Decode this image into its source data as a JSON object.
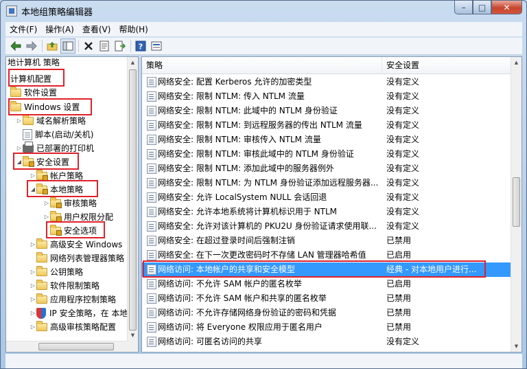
{
  "window": {
    "title": "本地组策略编辑器"
  },
  "caption": {
    "minimize": "–",
    "maximize": "□",
    "close": "✕"
  },
  "menu": [
    "文件(F)",
    "操作(A)",
    "查看(V)",
    "帮助(H)"
  ],
  "toolbar": {
    "icons": [
      "back-arrow-icon",
      "forward-arrow-icon",
      "up-folder-icon",
      "show-tree-icon",
      "delete-icon",
      "properties-icon",
      "export-icon",
      "help-icon",
      "view-icon"
    ]
  },
  "tree": {
    "root_label": "地计算机 策略",
    "items": [
      {
        "label": "计算机配置"
      },
      {
        "label": "软件设置"
      },
      {
        "label": "Windows 设置"
      },
      {
        "label": "域名解析策略"
      },
      {
        "label": "脚本(启动/关机)"
      },
      {
        "label": "已部署的打印机"
      },
      {
        "label": "安全设置"
      },
      {
        "label": "帐户策略"
      },
      {
        "label": "本地策略"
      },
      {
        "label": "审核策略"
      },
      {
        "label": "用户权限分配"
      },
      {
        "label": "安全选项"
      },
      {
        "label": "高级安全 Windows"
      },
      {
        "label": "网络列表管理器策略"
      },
      {
        "label": "公钥策略"
      },
      {
        "label": "软件限制策略"
      },
      {
        "label": "应用程序控制策略"
      },
      {
        "label": "IP 安全策略，在 本地"
      },
      {
        "label": "高级审核策略配置"
      }
    ]
  },
  "list": {
    "columns": {
      "policy": "策略",
      "setting": "安全设置"
    },
    "rows": [
      {
        "policy": "网络安全: 配置 Kerberos 允许的加密类型",
        "setting": "没有定义"
      },
      {
        "policy": "网络安全: 限制 NTLM: 传入 NTLM 流量",
        "setting": "没有定义"
      },
      {
        "policy": "网络安全: 限制 NTLM: 此域中的 NTLM 身份验证",
        "setting": "没有定义"
      },
      {
        "policy": "网络安全: 限制 NTLM: 到远程服务器的传出 NTLM 流量",
        "setting": "没有定义"
      },
      {
        "policy": "网络安全: 限制 NTLM: 审核传入 NTLM 流量",
        "setting": "没有定义"
      },
      {
        "policy": "网络安全: 限制 NTLM: 审核此域中的 NTLM 身份验证",
        "setting": "没有定义"
      },
      {
        "policy": "网络安全: 限制 NTLM: 添加此域中的服务器例外",
        "setting": "没有定义"
      },
      {
        "policy": "网络安全: 限制 NTLM: 为 NTLM 身份验证添加远程服务器...",
        "setting": "没有定义"
      },
      {
        "policy": "网络安全: 允许 LocalSystem NULL 会话回退",
        "setting": "没有定义"
      },
      {
        "policy": "网络安全: 允许本地系统将计算机标识用于 NTLM",
        "setting": "没有定义"
      },
      {
        "policy": "网络安全: 允许对该计算机的 PKU2U 身份验证请求使用联...",
        "setting": "没有定义"
      },
      {
        "policy": "网络安全: 在超过登录时间后强制注销",
        "setting": "已禁用"
      },
      {
        "policy": "网络安全: 在下一次更改密码时不存储 LAN 管理器哈希值",
        "setting": "已启用"
      },
      {
        "policy": "网络访问: 本地帐户的共享和安全模型",
        "setting": "经典 - 对本地用户进行..."
      },
      {
        "policy": "网络访问: 不允许 SAM 帐户的匿名枚举",
        "setting": "已启用"
      },
      {
        "policy": "网络访问: 不允许 SAM 帐户和共享的匿名枚举",
        "setting": "已禁用"
      },
      {
        "policy": "网络访问: 不允许存储网络身份验证的密码和凭据",
        "setting": "已禁用"
      },
      {
        "policy": "网络访问: 将 Everyone 权限应用于匿名用户",
        "setting": "已禁用"
      },
      {
        "policy": "网络访问: 可匿名访问的共享",
        "setting": "没有定义"
      }
    ],
    "selected_row_index": 13
  },
  "highlight_color": "#e0202a",
  "selection_color": "#3399ff"
}
